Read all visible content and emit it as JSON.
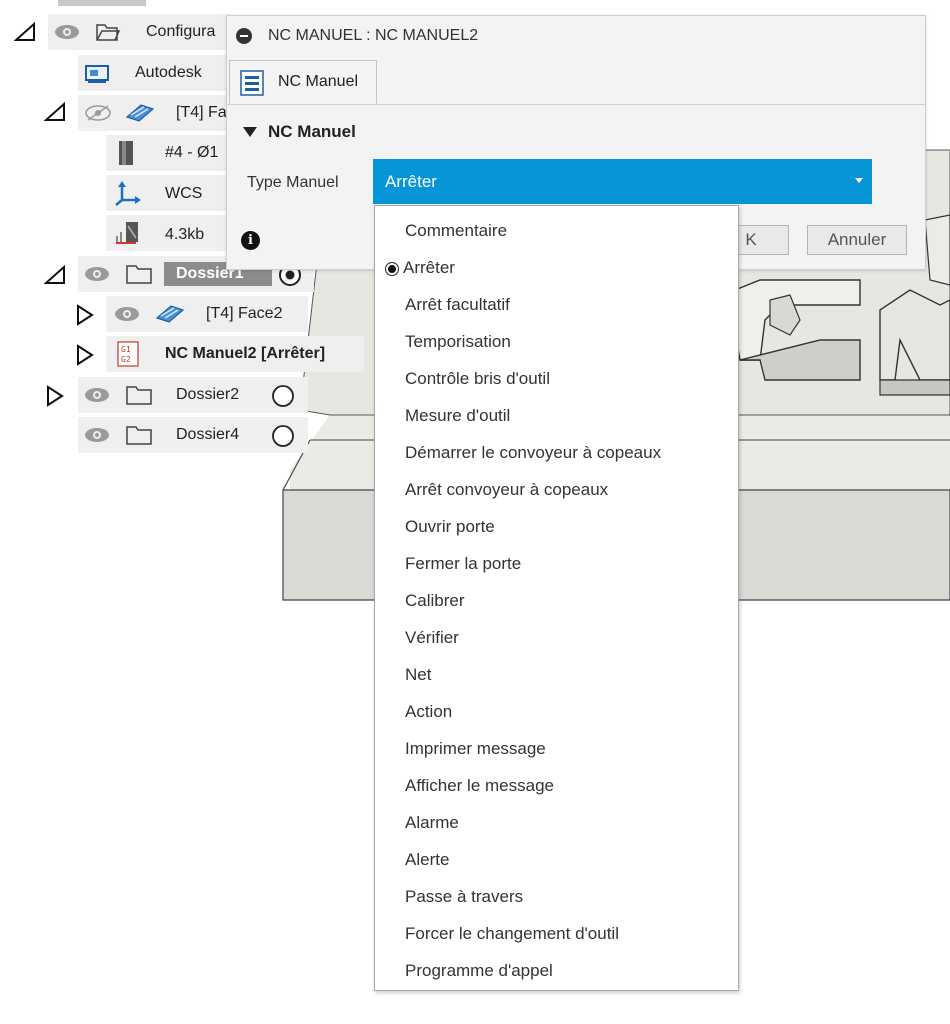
{
  "browser": {
    "setup": {
      "label": "Configura"
    },
    "machine": {
      "label": "Autodesk"
    },
    "face_op": {
      "label": "[T4] Fa"
    },
    "tool": {
      "label": "#4 - Ø1"
    },
    "wcs": {
      "label": "WCS"
    },
    "nc_size": {
      "label": "4.3kb"
    },
    "folder1": {
      "label": "Dossier1"
    },
    "face2": {
      "label": "[T4] Face2"
    },
    "nc_manual": {
      "label": "NC Manuel2 [Arrêter]",
      "icon_text": "G1\nG2"
    },
    "folder2": {
      "label": "Dossier2"
    },
    "folder4": {
      "label": "Dossier4"
    }
  },
  "dialog": {
    "title": "NC MANUEL : NC MANUEL2",
    "tab_label": "NC Manuel",
    "section_title": "NC Manuel",
    "type_label": "Type Manuel",
    "type_value": "Arrêter",
    "ok_label": "K",
    "cancel_label": "Annuler",
    "info_glyph": "i",
    "accent_color": "#0696d7"
  },
  "dropdown": {
    "selected": "Arrêter",
    "options": [
      "Commentaire",
      "Arrêter",
      "Arrêt facultatif",
      "Temporisation",
      "Contrôle bris d'outil",
      "Mesure d'outil",
      "Démarrer le convoyeur à copeaux",
      "Arrêt convoyeur à copeaux",
      "Ouvrir porte",
      "Fermer la porte",
      "Calibrer",
      "Vérifier",
      "Net",
      "Action",
      "Imprimer message",
      "Afficher le message",
      "Alarme",
      "Alerte",
      "Passe à travers",
      "Forcer le changement d'outil",
      "Programme d'appel"
    ]
  }
}
